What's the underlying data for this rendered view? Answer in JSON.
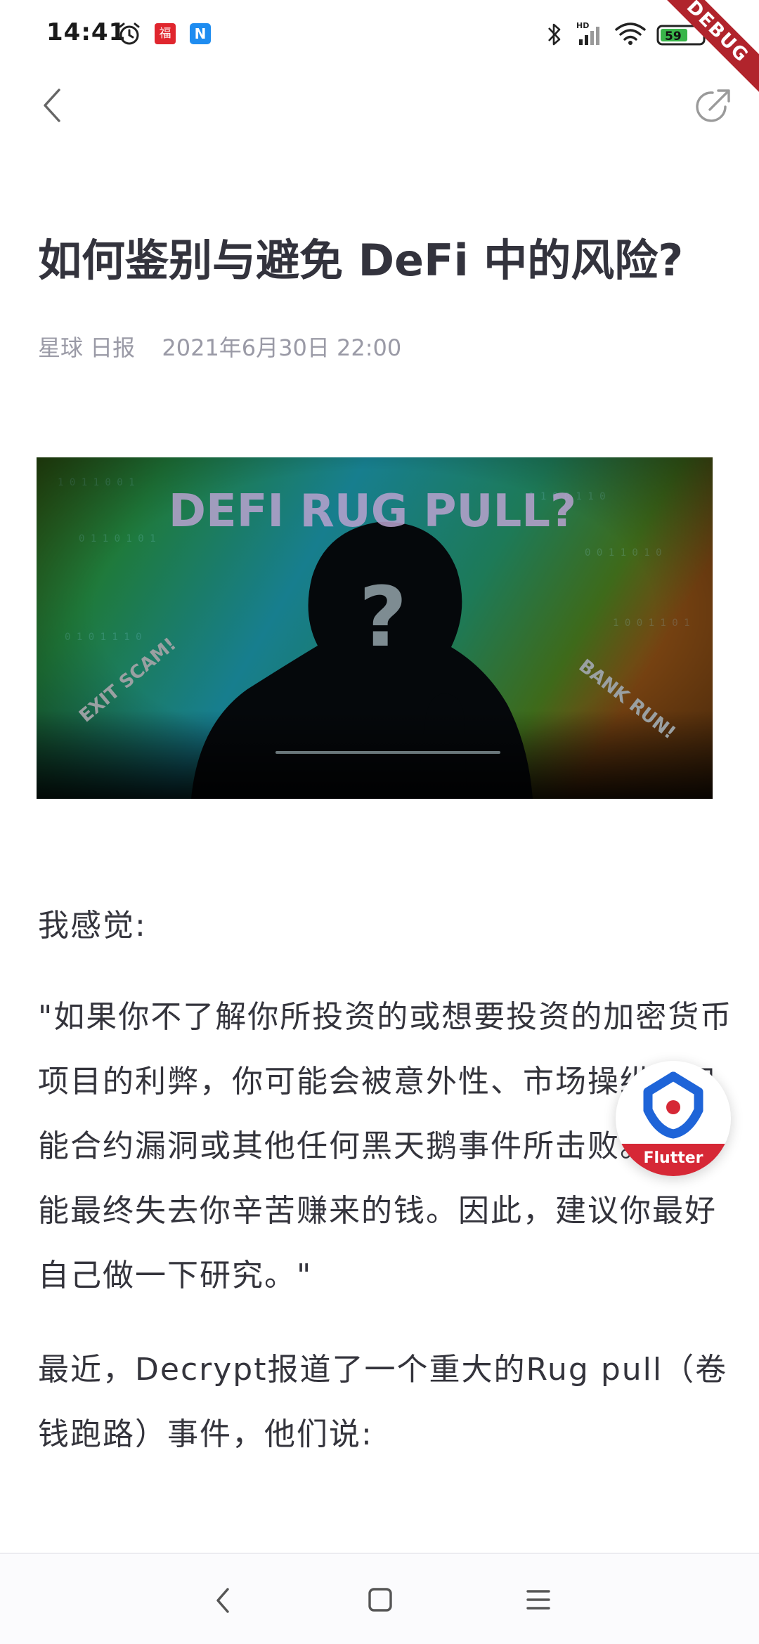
{
  "status_bar": {
    "time": "14:41",
    "app_badge_1": "福",
    "app_badge_2": "N",
    "signal_label": "HD",
    "battery_level": "59",
    "debug_banner": "DEBUG",
    "icons": [
      "alarm-icon",
      "bluetooth-icon",
      "signal-icon",
      "wifi-icon",
      "battery-icon",
      "charging-icon"
    ]
  },
  "app_bar": {
    "back_icon": "chevron-left-icon",
    "share_icon": "share-icon"
  },
  "article": {
    "title": "如何鉴别与避免 DeFi 中的风险?",
    "source": "星球 日报",
    "published": "2021年6月30日 22:00",
    "hero_image": {
      "headline": "DEFI RUG PULL?",
      "left_text": "EXIT SCAM!",
      "right_text": "BANK RUN!"
    },
    "paragraphs": [
      "我感觉:",
      "\"如果你不了解你所投资的或想要投资的加密货币项目的利弊，你可能会被意外性、市场操纵、智能合约漏洞或其他任何黑天鹅事件所击败。你可能最终失去你辛苦赚来的钱。因此，建议你最好自己做一下研究。\"",
      "最近，Decrypt报道了一个重大的Rug pull（卷钱跑路）事件，他们说:"
    ]
  },
  "flutter_badge": {
    "label": "Flutter"
  },
  "nav_bar": {
    "icons": [
      "nav-back-icon",
      "nav-home-icon",
      "nav-menu-icon"
    ]
  },
  "colors": {
    "title": "#33333d",
    "meta": "#9a9aa6",
    "body_text": "#34343c",
    "debug_ribbon": "#b1242c",
    "flutter_red": "#d62836",
    "flutter_blue": "#1e64d8"
  }
}
